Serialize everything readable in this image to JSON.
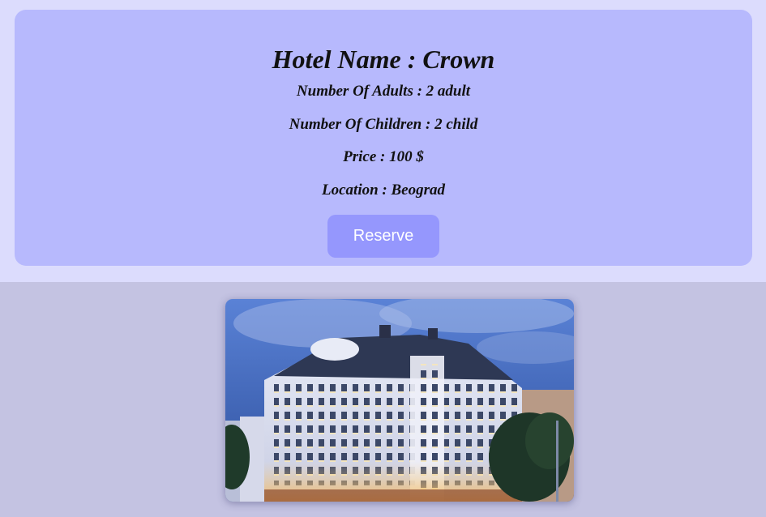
{
  "hotel": {
    "title": "Hotel Name : Crown",
    "adults": "Number Of Adults : 2 adult",
    "children": "Number Of Children : 2 child",
    "price": "Price : 100 $",
    "location": "Location : Beograd",
    "reserve_label": "Reserve"
  },
  "colors": {
    "page_background": "#c4c3e2",
    "header_band": "#dcdcfd",
    "card": "#b7b9fd",
    "button": "#9597fd",
    "button_text": "#ffffff"
  },
  "image": {
    "subject": "hotel-building-photo"
  }
}
